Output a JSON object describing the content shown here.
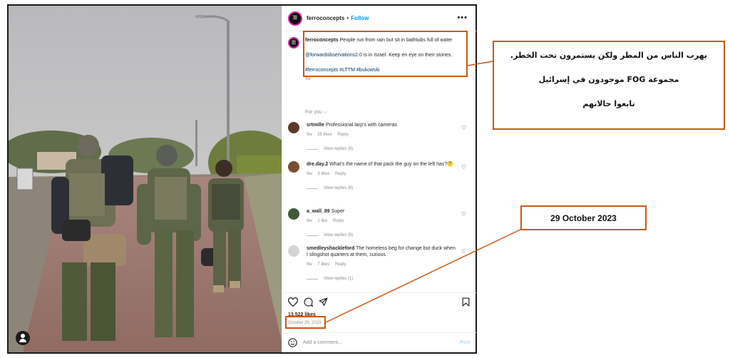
{
  "post": {
    "username": "ferroconcepts",
    "dot": "•",
    "follow_label": "Follow",
    "more_label": "•••",
    "caption": {
      "text_line": "People run from rain but sit in bathtubs full of water",
      "mention": "@forwardobservations2.0",
      "mention_rest": " is in Israel. Keep en eye on their stories.",
      "hashtags": "#ferroconcepts #LTTM #bukowski",
      "time": "9w"
    },
    "for_you": "For you ⌵",
    "comments": [
      {
        "username": "srtmille",
        "text": "Professional larp's with cameras",
        "time": "9w",
        "likes": "25 likes",
        "reply": "Reply",
        "view_replies": "View replies (8)",
        "avatar_color": "#5a3b2a"
      },
      {
        "username": "dre.day.2",
        "text": "What's the name of that pack the guy on the left has?🤔",
        "time": "9w",
        "likes": "3 likes",
        "reply": "Reply",
        "view_replies": "View replies (6)",
        "avatar_color": "#7a4e2e"
      },
      {
        "username": "a_wall_89",
        "text": "Super",
        "time": "9w",
        "likes": "1 like",
        "reply": "Reply",
        "view_replies": "View replies (8)",
        "avatar_color": "#3f5a3a"
      },
      {
        "username": "smedleyshackleford",
        "text": "The homeless beg for change but duck when I slingshot quarters at them, curious",
        "time": "9w",
        "likes": "7 likes",
        "reply": "Reply",
        "view_replies": "View replies (1)",
        "avatar_color": "#d4d4d4"
      }
    ],
    "likes_count": "13,522 likes",
    "date": "October 29, 2023",
    "add_comment_placeholder": "Add a comment...",
    "post_label": "Post",
    "icons": [
      "heart-icon",
      "comment-icon",
      "share-icon",
      "bookmark-icon",
      "emoji-icon"
    ]
  },
  "annotations": {
    "arabic_lines": [
      "يهرب الناس من المطر ولكن يستمرون تحت الخطر.",
      "مجموعة FOG موجودون في إسرائيل",
      "تابعوا حالاتهم"
    ],
    "date_label": "29 October 2023",
    "accent_color": "#c55a11"
  }
}
